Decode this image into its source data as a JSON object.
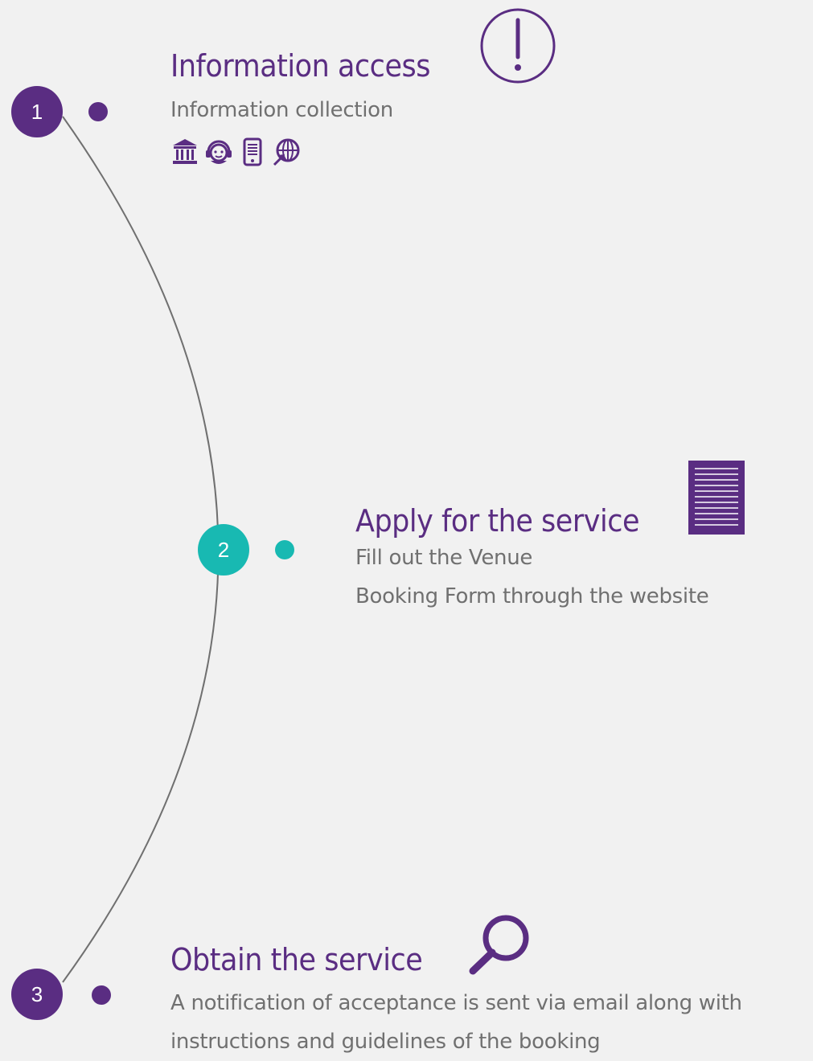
{
  "colors": {
    "primary": "#5a2d82",
    "accent": "#18b9b2",
    "text": "#707070",
    "line": "#707070",
    "background": "#f1f1f1"
  },
  "steps": [
    {
      "number": "1",
      "title": "Information access",
      "description_lines": [
        "Information collection"
      ],
      "icon": "exclamation-circle-icon",
      "channels": [
        "institution-building-icon",
        "call-center-agent-icon",
        "mobile-phone-icon",
        "website-globe-icon"
      ]
    },
    {
      "number": "2",
      "title": "Apply for the service",
      "description_lines": [
        "Fill out the Venue",
        "Booking Form through the website"
      ],
      "icon": "form-document-icon"
    },
    {
      "number": "3",
      "title": "Obtain the service",
      "description_lines": [
        "A notification of acceptance is sent via email along with",
        "instructions and guidelines of the booking"
      ],
      "icon": "magnifier-search-icon"
    }
  ]
}
